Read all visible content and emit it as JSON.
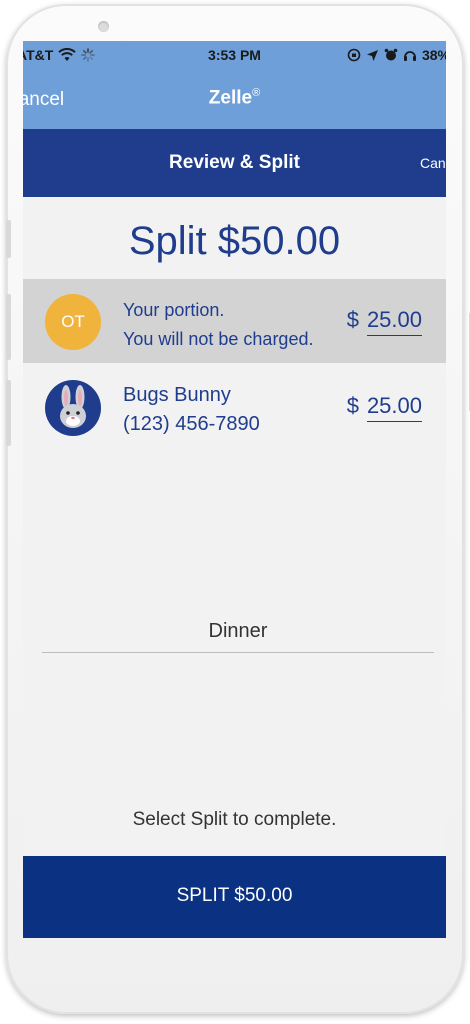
{
  "status_bar": {
    "carrier": "AT&T",
    "time": "3:53 PM",
    "battery": "38%"
  },
  "nav": {
    "cancel_label": "Cancel",
    "title": "Zelle",
    "title_mark": "®"
  },
  "header": {
    "title": "Review & Split",
    "cancel_label": "Cancel"
  },
  "split_heading": "Split $50.00",
  "participants": [
    {
      "initials": "OT",
      "line1": "Your portion.",
      "line2": "You will not be charged.",
      "currency": "$",
      "amount": "25.00",
      "avatar_color": "#f0b33c",
      "highlighted": true
    },
    {
      "name": "Bugs Bunny",
      "phone": "(123) 456-7890",
      "currency": "$",
      "amount": "25.00",
      "avatar_icon": "bunny-icon",
      "highlighted": false
    }
  ],
  "memo_value": "Dinner",
  "hint": "Select Split to complete.",
  "split_button_label": "SPLIT $50.00",
  "colors": {
    "nav_blue": "#6f9fd8",
    "header_blue": "#1f3d8c",
    "button_blue": "#0b3182",
    "highlight_row": "#d3d3d3",
    "ot_avatar": "#f0b33c"
  }
}
